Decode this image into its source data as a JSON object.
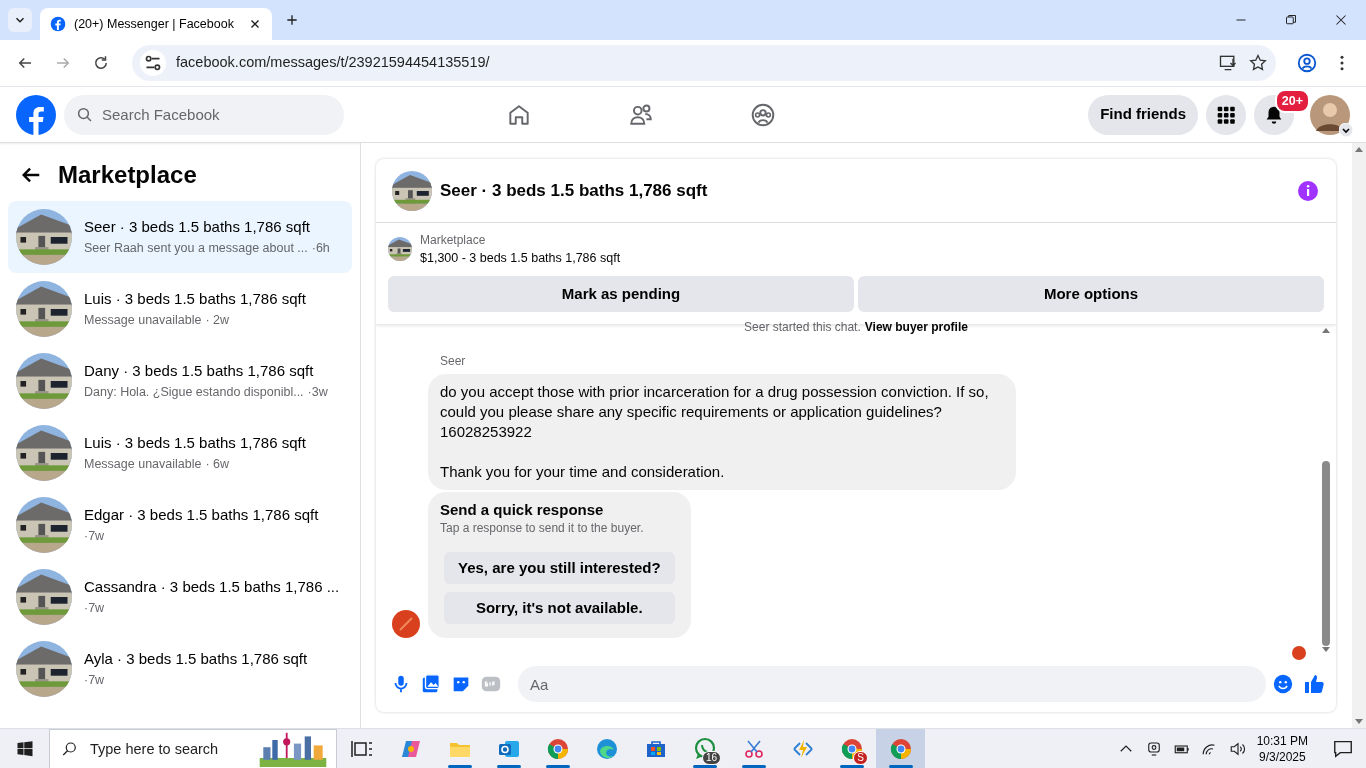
{
  "browser": {
    "tab_title": "(20+) Messenger | Facebook",
    "url": "facebook.com/messages/t/23921594454135519/"
  },
  "header": {
    "search_placeholder": "Search Facebook",
    "find_friends": "Find friends",
    "notification_count": "20+"
  },
  "sidebar": {
    "title": "Marketplace",
    "conversations": [
      {
        "title": "Seer · 3 beds 1.5 baths 1,786 sqft",
        "preview": "Seer Raah sent you a message about ...",
        "time": "·6h",
        "selected": true
      },
      {
        "title": "Luis · 3 beds 1.5 baths 1,786 sqft",
        "preview": "Message unavailable",
        "time": "· 2w",
        "selected": false
      },
      {
        "title": "Dany · 3 beds 1.5 baths 1,786 sqft",
        "preview": "Dany: Hola. ¿Sigue estando disponibl...",
        "time": "·3w",
        "selected": false
      },
      {
        "title": "Luis · 3 beds 1.5 baths 1,786 sqft",
        "preview": "Message unavailable",
        "time": "· 6w",
        "selected": false
      },
      {
        "title": "Edgar · 3 beds 1.5 baths 1,786 sqft",
        "time": "·7w",
        "selected": false
      },
      {
        "title": "Cassandra · 3 beds 1.5 baths 1,786 ...",
        "time": "·7w",
        "selected": false
      },
      {
        "title": "Ayla · 3 beds 1.5 baths 1,786 sqft",
        "time": "·7w",
        "selected": false
      }
    ]
  },
  "chat": {
    "title": "Seer · 3 beds 1.5 baths 1,786 sqft",
    "listing": {
      "label": "Marketplace",
      "summary": "$1,300 - 3 beds 1.5 baths 1,786 sqft"
    },
    "actions": [
      "Mark as pending",
      "More options"
    ],
    "started_note": "Seer started this chat.",
    "started_link": "View buyer profile",
    "messages": [
      {
        "sender": "Seer",
        "text": "do you accept those with prior incarceration for a drug possession conviction.  If so, could you please share any specific requirements or application guidelines?\n16028253922\n\nThank you for your time and consideration."
      }
    ],
    "quick_response": {
      "title": "Send a quick response",
      "hint": "Tap a response to send it to the buyer.",
      "options": [
        "Yes, are you still interested?",
        "Sorry, it's not available."
      ]
    },
    "composer": {
      "placeholder": "Aa"
    }
  },
  "taskbar": {
    "search_placeholder": "Type here to search",
    "time": "10:31 PM",
    "date": "9/3/2025",
    "apps": [
      {
        "kind": "taskview",
        "running": false,
        "selected": false
      },
      {
        "kind": "copilot",
        "running": false,
        "selected": false
      },
      {
        "kind": "folder",
        "running": true,
        "selected": false
      },
      {
        "kind": "mail",
        "running": true,
        "selected": false
      },
      {
        "kind": "chrome",
        "running": true,
        "selected": false
      },
      {
        "kind": "edge",
        "running": false,
        "selected": false
      },
      {
        "kind": "store",
        "running": false,
        "selected": false
      },
      {
        "kind": "whatsapp",
        "running": true,
        "selected": false,
        "badge": "16"
      },
      {
        "kind": "snip",
        "running": true,
        "selected": false
      },
      {
        "kind": "bolt",
        "running": false,
        "selected": false
      },
      {
        "kind": "chrome",
        "running": true,
        "selected": false,
        "badge": "S"
      },
      {
        "kind": "chrome",
        "running": true,
        "selected": true
      }
    ]
  }
}
